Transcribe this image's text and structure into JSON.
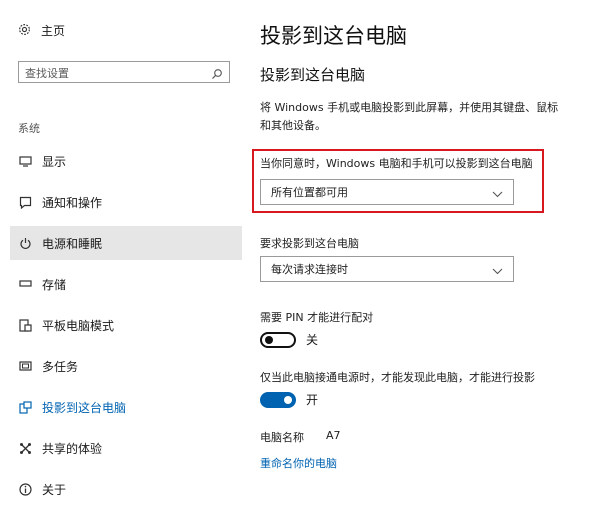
{
  "sidebar": {
    "home_label": "主页",
    "search_placeholder": "查找设置",
    "section": "系统",
    "items": [
      {
        "label": "显示",
        "icon": "monitor-icon"
      },
      {
        "label": "通知和操作",
        "icon": "notification-icon"
      },
      {
        "label": "电源和睡眠",
        "icon": "power-icon"
      },
      {
        "label": "存储",
        "icon": "storage-icon"
      },
      {
        "label": "平板电脑模式",
        "icon": "tablet-mode-icon"
      },
      {
        "label": "多任务",
        "icon": "multitask-icon"
      },
      {
        "label": "投影到这台电脑",
        "icon": "project-icon"
      },
      {
        "label": "共享的体验",
        "icon": "shared-experience-icon"
      },
      {
        "label": "关于",
        "icon": "info-icon"
      }
    ]
  },
  "main": {
    "page_title": "投影到这台电脑",
    "sub_title": "投影到这台电脑",
    "description": "将 Windows 手机或电脑投影到此屏幕，并使用其键盘、鼠标和其他设备。",
    "setting1": {
      "label": "当你同意时，Windows 电脑和手机可以投影到这台电脑",
      "value": "所有位置都可用"
    },
    "setting2": {
      "label": "要求投影到这台电脑",
      "value": "每次请求连接时"
    },
    "pin": {
      "label": "需要 PIN 才能进行配对",
      "state": "关"
    },
    "power": {
      "label": "仅当此电脑接通电源时，才能发现此电脑，才能进行投影",
      "state": "开"
    },
    "pc_name_label": "电脑名称",
    "pc_name_value": "A7",
    "rename_link": "重命名你的电脑"
  },
  "colors": {
    "accent": "#0063b1",
    "highlight_border": "#d7191f",
    "active_bg": "#e6e6e6"
  }
}
